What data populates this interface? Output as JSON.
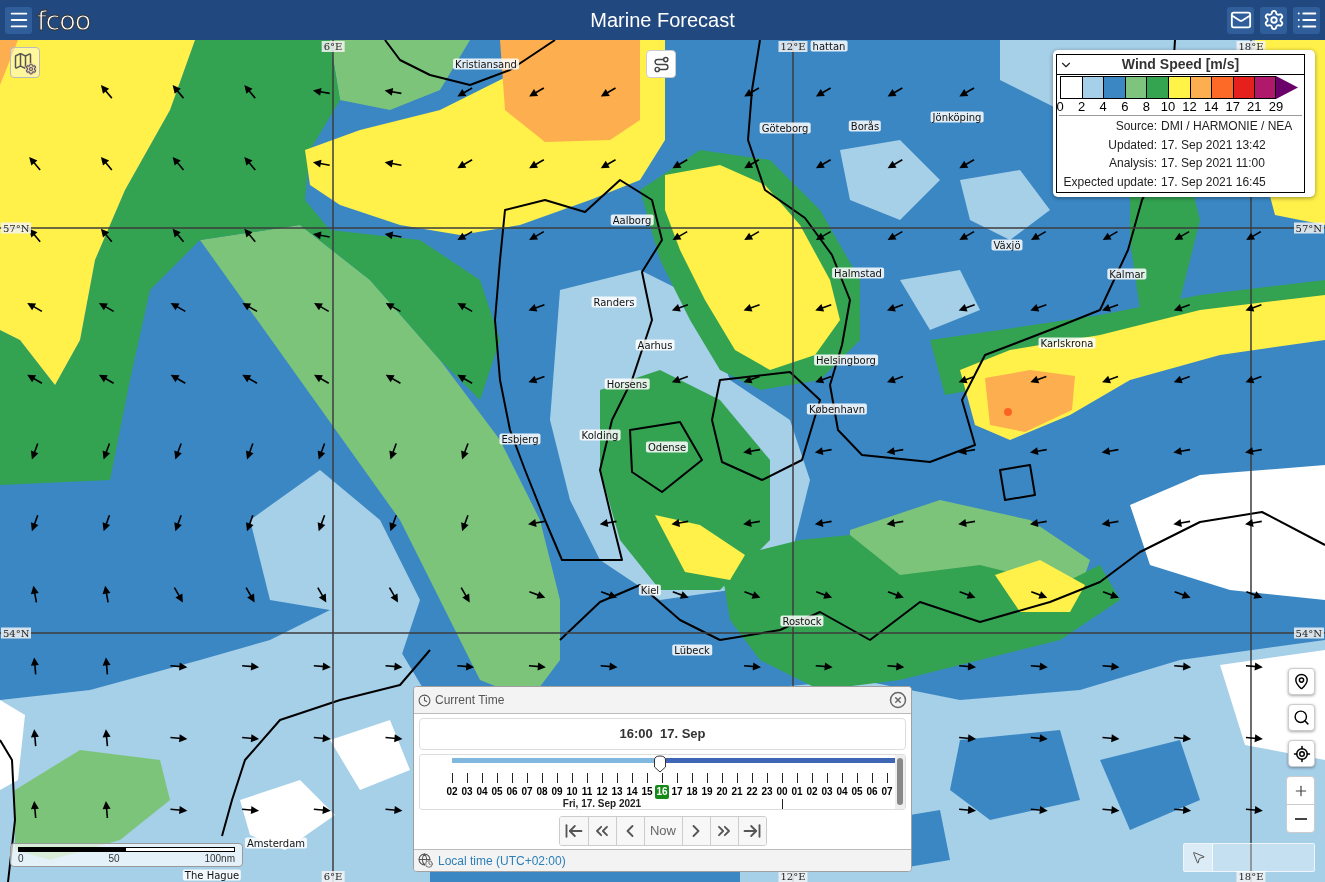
{
  "header": {
    "logo": "fcoo",
    "title": "Marine Forecast"
  },
  "map": {
    "grid_labels": {
      "top": [
        "6°E",
        "12°E",
        "18°E"
      ],
      "bottom": [
        "6°E",
        "12°E",
        "18°E"
      ],
      "left": [
        "57°N",
        "54°N"
      ],
      "right": [
        "57°N",
        "54°N"
      ]
    },
    "places": [
      "hattan",
      "Kristiansand",
      "Göteborg",
      "Borås",
      "Jönköping",
      "Aalborg",
      "Växjö",
      "Halmstad",
      "Kalmar",
      "Randers",
      "Aarhus",
      "Karlskrona",
      "Helsingborg",
      "Horsens",
      "København",
      "Kolding",
      "Esbjerg",
      "Odense",
      "Kiel",
      "Rostock",
      "Lübeck",
      "Amsterdam",
      "The Hague"
    ],
    "scale_labels": [
      "0",
      "50",
      "100nm"
    ]
  },
  "legend": {
    "title": "Wind Speed [m/s]",
    "expanded": true,
    "bins": [
      {
        "kind": "cell",
        "color": "#ffffff"
      },
      {
        "kind": "cell",
        "color": "#a6d0ea"
      },
      {
        "kind": "cell",
        "color": "#3a87c4"
      },
      {
        "kind": "cell",
        "color": "#7fc47e"
      },
      {
        "kind": "cell",
        "color": "#34a451"
      },
      {
        "kind": "cell",
        "color": "#fff347"
      },
      {
        "kind": "cell",
        "color": "#fdae4f"
      },
      {
        "kind": "cell",
        "color": "#fd6a27"
      },
      {
        "kind": "cell",
        "color": "#e5201d"
      },
      {
        "kind": "cell",
        "color": "#b0186c"
      },
      {
        "kind": "arrow",
        "color": "#6b006b"
      }
    ],
    "ticks": [
      "0",
      "2",
      "4",
      "6",
      "8",
      "10",
      "12",
      "14",
      "17",
      "21",
      "29"
    ],
    "info": [
      {
        "label": "Source:",
        "value": "DMI / HARMONIE / NEA"
      },
      {
        "label": "Updated:",
        "value": "17. Sep 2021 13:42"
      },
      {
        "label": "Analysis:",
        "value": "17. Sep 2021 11:00"
      },
      {
        "label": "Expected update:",
        "value": "17. Sep 2021 16:45"
      }
    ]
  },
  "time_panel": {
    "title": "Current Time",
    "display": "16:00  17. Sep",
    "slider": {
      "level": 0.47
    },
    "hours": [
      {
        "label": "02",
        "selected": false
      },
      {
        "label": "03",
        "selected": false
      },
      {
        "label": "04",
        "selected": false
      },
      {
        "label": "05",
        "selected": false
      },
      {
        "label": "06",
        "selected": false
      },
      {
        "label": "07",
        "selected": false
      },
      {
        "label": "08",
        "selected": false
      },
      {
        "label": "09",
        "selected": false
      },
      {
        "label": "10",
        "selected": false
      },
      {
        "label": "11",
        "selected": false
      },
      {
        "label": "12",
        "selected": false
      },
      {
        "label": "13",
        "selected": false
      },
      {
        "label": "14",
        "selected": false
      },
      {
        "label": "15",
        "selected": false
      },
      {
        "label": "16",
        "selected": true
      },
      {
        "label": "17",
        "selected": false
      },
      {
        "label": "18",
        "selected": false
      },
      {
        "label": "19",
        "selected": false
      },
      {
        "label": "20",
        "selected": false
      },
      {
        "label": "21",
        "selected": false
      },
      {
        "label": "22",
        "selected": false
      },
      {
        "label": "23",
        "selected": false
      },
      {
        "label": "00",
        "selected": false
      },
      {
        "label": "01",
        "selected": false
      },
      {
        "label": "02",
        "selected": false
      },
      {
        "label": "03",
        "selected": false
      },
      {
        "label": "04",
        "selected": false
      },
      {
        "label": "05",
        "selected": false
      },
      {
        "label": "06",
        "selected": false
      },
      {
        "label": "07",
        "selected": false
      }
    ],
    "date_label": "Fri, 17. Sep 2021",
    "nav": [
      {
        "kind": "first"
      },
      {
        "kind": "fast_back"
      },
      {
        "kind": "back"
      },
      {
        "kind": "now",
        "label": "Now"
      },
      {
        "kind": "forward"
      },
      {
        "kind": "fast_forward"
      },
      {
        "kind": "last"
      }
    ],
    "footer_link": "Local time (UTC+02:00)"
  }
}
